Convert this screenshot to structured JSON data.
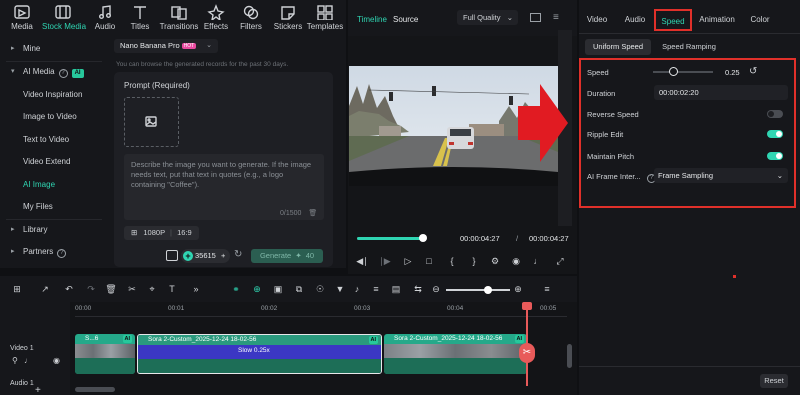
{
  "toolbar": {
    "items": [
      {
        "label": "Media",
        "icon": "media-icon"
      },
      {
        "label": "Stock Media",
        "icon": "stock-media-icon"
      },
      {
        "label": "Audio",
        "icon": "audio-icon"
      },
      {
        "label": "Titles",
        "icon": "titles-icon"
      },
      {
        "label": "Transitions",
        "icon": "transitions-icon"
      },
      {
        "label": "Effects",
        "icon": "effects-icon"
      },
      {
        "label": "Filters",
        "icon": "filters-icon"
      },
      {
        "label": "Stickers",
        "icon": "stickers-icon"
      },
      {
        "label": "Templates",
        "icon": "templates-icon"
      }
    ],
    "active": "Stock Media"
  },
  "sidebar": {
    "items": [
      {
        "label": "Mine",
        "type": "group"
      },
      {
        "label": "AI Media",
        "type": "group",
        "badge": "AI"
      },
      {
        "label": "Video Inspiration",
        "type": "item"
      },
      {
        "label": "Image to Video",
        "type": "item"
      },
      {
        "label": "Text to Video",
        "type": "item"
      },
      {
        "label": "Video Extend",
        "type": "item"
      },
      {
        "label": "AI Image",
        "type": "item",
        "active": true
      },
      {
        "label": "My Files",
        "type": "item"
      },
      {
        "label": "Library",
        "type": "group"
      },
      {
        "label": "Partners",
        "type": "group"
      }
    ]
  },
  "ai_image": {
    "model": "Nano Banana Pro",
    "model_badge": "HOT",
    "note": "You can browse the generated records for the past 30 days.",
    "prompt_title": "Prompt (Required)",
    "prompt_placeholder": "Describe the image you want to generate. If the image needs text, put that text in quotes (e.g., a logo containing \"Coffee\").",
    "char_count": "0/1500",
    "resolution": "1080P",
    "ratio": "16:9",
    "credits": "35615",
    "generate_label": "Generate",
    "generate_cost": "40"
  },
  "preview": {
    "tab_timeline": "Timeline",
    "tab_source": "Source",
    "quality": "Full Quality",
    "current_time": "00:00:04:27",
    "separator": "/",
    "total_time": "00:00:04:27",
    "scrub_progress": 0.94
  },
  "properties": {
    "tabs": [
      "Video",
      "Audio",
      "Speed",
      "Animation",
      "Color"
    ],
    "active_tab": "Speed",
    "subtabs": [
      "Uniform Speed",
      "Speed Ramping"
    ],
    "speed_label": "Speed",
    "speed_value": "0.25",
    "speed_slider": 0.1,
    "duration_label": "Duration",
    "duration_value": "00:00:02:20",
    "reverse_label": "Reverse Speed",
    "reverse_on": false,
    "ripple_label": "Ripple Edit",
    "ripple_on": true,
    "pitch_label": "Maintain Pitch",
    "pitch_on": true,
    "interp_label": "AI Frame Inter...",
    "interp_value": "Frame Sampling",
    "reset_label": "Reset"
  },
  "timeline": {
    "ruler": [
      "00:00",
      "00:01",
      "00:02",
      "00:03",
      "00:04",
      "00:05"
    ],
    "track_video": "Video 1",
    "track_audio": "Audio 1",
    "clips": [
      {
        "title": "S...6",
        "ai": "AI"
      },
      {
        "title": "Sora 2-Custom_2025-12-24 18-02-56",
        "ai": "AI",
        "speed_label": "Slow 0.25x"
      },
      {
        "title": "Sora 2-Custom_2025-12-24 18-02-56",
        "ai": "AI"
      }
    ]
  },
  "colors": {
    "accent": "#2fd5b2",
    "highlight_box": "#e0302a",
    "playhead": "#e85a5a"
  }
}
